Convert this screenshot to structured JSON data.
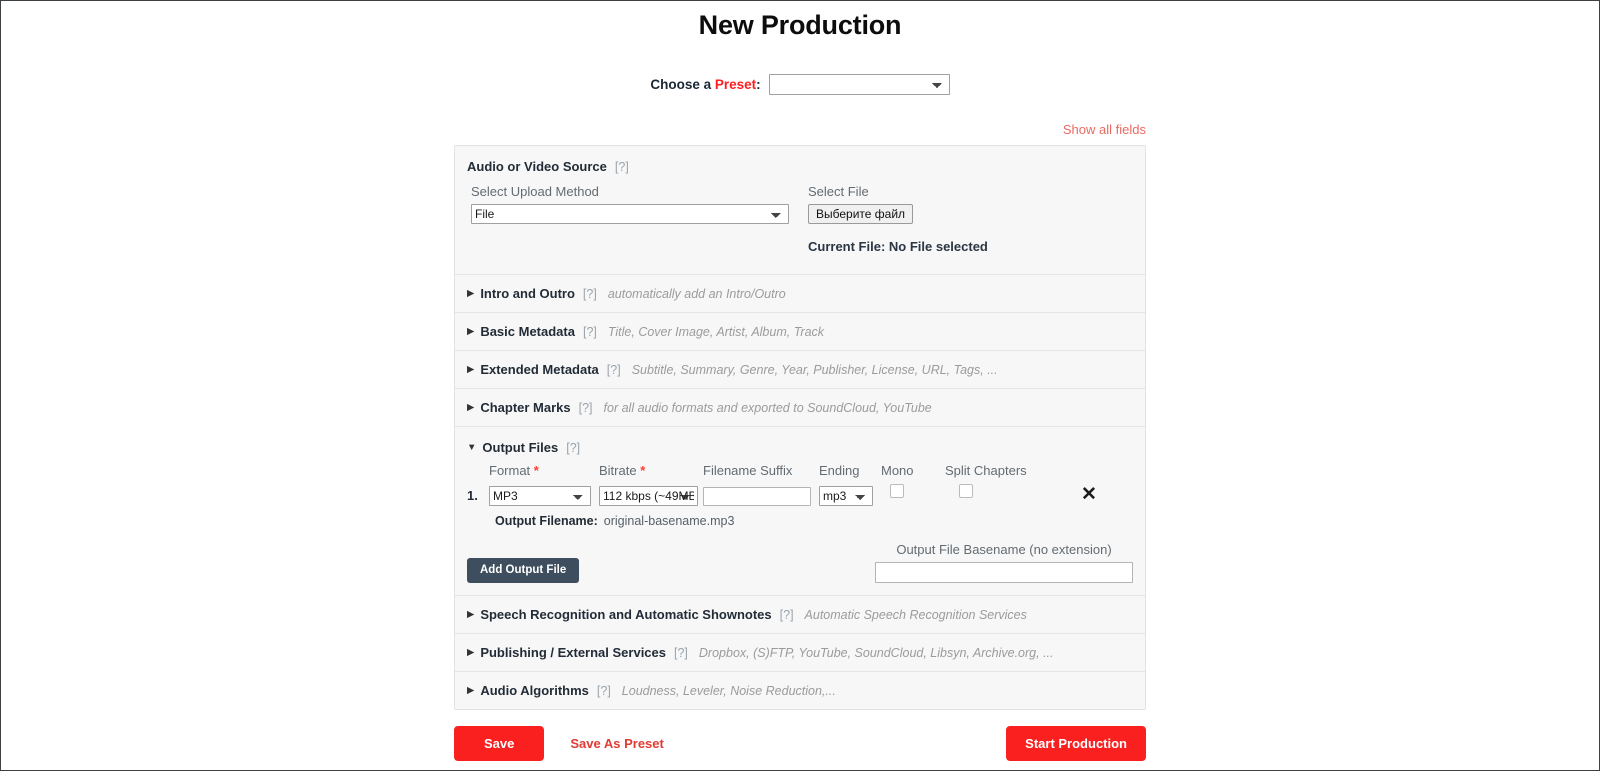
{
  "page": {
    "title": "New Production"
  },
  "preset": {
    "label_pre": "Choose a ",
    "label_accent": "Preset",
    "label_post": ":",
    "selected": "",
    "options": [
      ""
    ]
  },
  "show_all_fields": "Show all fields",
  "source_section": {
    "title": "Audio or Video Source",
    "help": "[?]",
    "triangle": "▼",
    "upload_method_label": "Select Upload Method",
    "upload_method_value": "File",
    "upload_method_options": [
      "File"
    ],
    "select_file_label": "Select File",
    "file_button_label": "Выберите файл",
    "current_file": "Current File: No File selected"
  },
  "sections": [
    {
      "title": "Intro and Outro",
      "help": "[?]",
      "triangle": "▶",
      "hint": "automatically add an Intro/Outro"
    },
    {
      "title": "Basic Metadata",
      "help": "[?]",
      "triangle": "▶",
      "hint": "Title, Cover Image, Artist, Album, Track"
    },
    {
      "title": "Extended Metadata",
      "help": "[?]",
      "triangle": "▶",
      "hint": "Subtitle, Summary, Genre, Year, Publisher, License, URL, Tags, ..."
    },
    {
      "title": "Chapter Marks",
      "help": "[?]",
      "triangle": "▶",
      "hint": "for all audio formats and exported to SoundCloud, YouTube"
    }
  ],
  "output_files": {
    "title": "Output Files",
    "help": "[?]",
    "triangle": "▼",
    "columns": {
      "format": "Format",
      "format_required": "*",
      "bitrate": "Bitrate",
      "bitrate_required": "*",
      "filename_suffix": "Filename Suffix",
      "ending": "Ending",
      "mono": "Mono",
      "split_chapters": "Split Chapters"
    },
    "row": {
      "index": "1.",
      "format_value": "MP3",
      "format_options": [
        "MP3"
      ],
      "bitrate_value": "112 kbps (~49MB",
      "bitrate_options": [
        "112 kbps (~49MB"
      ],
      "suffix_value": "",
      "suffix_placeholder": "",
      "ending_value": "mp3",
      "ending_options": [
        "mp3"
      ],
      "mono_checked": false,
      "split_chapters_checked": false,
      "remove_icon": "✕"
    },
    "output_filename_label": "Output Filename:",
    "output_filename_value": "original-basename.mp3",
    "add_output_button": "Add Output File",
    "basename_label": "Output File Basename (no extension)",
    "basename_value": "",
    "basename_placeholder": ""
  },
  "sections_after": [
    {
      "title": "Speech Recognition and Automatic Shownotes",
      "help": "[?]",
      "triangle": "▶",
      "hint": "Automatic Speech Recognition Services"
    },
    {
      "title": "Publishing / External Services",
      "help": "[?]",
      "triangle": "▶",
      "hint": "Dropbox, (S)FTP, YouTube, SoundCloud, Libsyn, Archive.org, ..."
    },
    {
      "title": "Audio Algorithms",
      "help": "[?]",
      "triangle": "▶",
      "hint": "Loudness, Leveler, Noise Reduction,..."
    }
  ],
  "footer": {
    "save": "Save",
    "save_as_preset": "Save As Preset",
    "start_production": "Start Production"
  },
  "colors": {
    "accent_red": "#fa2020",
    "link_red": "#ea6a63",
    "preset_red": "#ff1e1e",
    "dark_button": "#3e4e5e",
    "panel_bg": "#f7f7f7",
    "panel_border": "#e2e2e2"
  }
}
